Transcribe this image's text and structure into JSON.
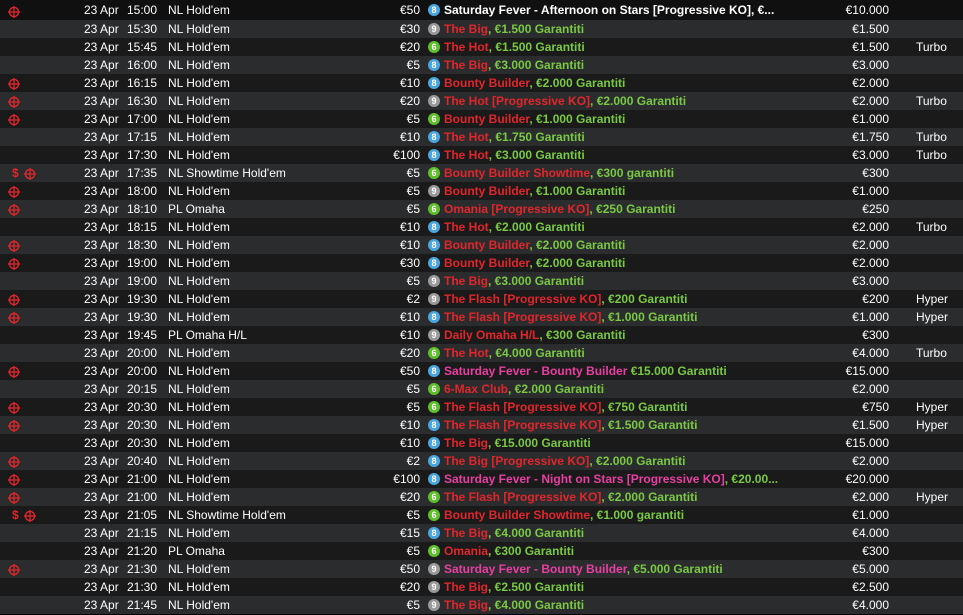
{
  "colors": {
    "red": "#e0262b",
    "pink": "#e83fa3",
    "green": "#7ac943",
    "alt_row": "#2b2c2e",
    "row": "#1a1a1a"
  },
  "rows": [
    {
      "flags": [
        "target-icon"
      ],
      "date": "23 Apr",
      "time": "15:00",
      "game": "NL Hold'em",
      "buyin": "€50",
      "speed": "8",
      "name_a": "Saturday Fever - Afternoon on Stars [Progressive KO], €...",
      "name_b": "",
      "style": "white",
      "prize": "€10.000",
      "type": ""
    },
    {
      "flags": [],
      "date": "23 Apr",
      "time": "15:30",
      "game": "NL Hold'em",
      "buyin": "€30",
      "speed": "9",
      "name_a": "The Big",
      "name_b": ", €1.500 Garantiti",
      "style": "red",
      "prize": "€1.500",
      "type": ""
    },
    {
      "flags": [],
      "date": "23 Apr",
      "time": "15:45",
      "game": "NL Hold'em",
      "buyin": "€20",
      "speed": "6",
      "name_a": "The Hot",
      "name_b": ", €1.500 Garantiti",
      "style": "red",
      "prize": "€1.500",
      "type": "Turbo"
    },
    {
      "flags": [],
      "date": "23 Apr",
      "time": "16:00",
      "game": "NL Hold'em",
      "buyin": "€5",
      "speed": "8",
      "name_a": "The Big",
      "name_b": ", €3.000 Garantiti",
      "style": "red",
      "prize": "€3.000",
      "type": ""
    },
    {
      "flags": [
        "target-icon"
      ],
      "date": "23 Apr",
      "time": "16:15",
      "game": "NL Hold'em",
      "buyin": "€10",
      "speed": "8",
      "name_a": "Bounty Builder",
      "name_b": ", €2.000 Garantiti",
      "style": "red",
      "prize": "€2.000",
      "type": ""
    },
    {
      "flags": [
        "target-icon"
      ],
      "date": "23 Apr",
      "time": "16:30",
      "game": "NL Hold'em",
      "buyin": "€20",
      "speed": "9",
      "name_a": "The Hot [Progressive KO]",
      "name_b": ", €2.000 Garantiti",
      "style": "red",
      "prize": "€2.000",
      "type": "Turbo"
    },
    {
      "flags": [
        "target-icon"
      ],
      "date": "23 Apr",
      "time": "17:00",
      "game": "NL Hold'em",
      "buyin": "€5",
      "speed": "6",
      "name_a": "Bounty Builder",
      "name_b": ", €1.000 Garantiti",
      "style": "red",
      "prize": "€1.000",
      "type": ""
    },
    {
      "flags": [],
      "date": "23 Apr",
      "time": "17:15",
      "game": "NL Hold'em",
      "buyin": "€10",
      "speed": "8",
      "name_a": "The Hot",
      "name_b": ", €1.750 Garantiti",
      "style": "red",
      "prize": "€1.750",
      "type": "Turbo"
    },
    {
      "flags": [],
      "date": "23 Apr",
      "time": "17:30",
      "game": "NL Hold'em",
      "buyin": "€100",
      "speed": "8",
      "name_a": "The Hot",
      "name_b": ", €3.000 Garantiti",
      "style": "red",
      "prize": "€3.000",
      "type": "Turbo"
    },
    {
      "flags": [
        "dollar-icon",
        "target-icon"
      ],
      "date": "23 Apr",
      "time": "17:35",
      "game": "NL Showtime Hold'em",
      "buyin": "€5",
      "speed": "6",
      "name_a": "Bounty Builder Showtime",
      "name_b": ", €300 garantiti",
      "style": "red",
      "prize": "€300",
      "type": ""
    },
    {
      "flags": [
        "target-icon"
      ],
      "date": "23 Apr",
      "time": "18:00",
      "game": "NL Hold'em",
      "buyin": "€5",
      "speed": "9",
      "name_a": "Bounty Builder",
      "name_b": ", €1.000 Garantiti",
      "style": "red",
      "prize": "€1.000",
      "type": ""
    },
    {
      "flags": [
        "target-icon"
      ],
      "date": "23 Apr",
      "time": "18:10",
      "game": "PL Omaha",
      "buyin": "€5",
      "speed": "6",
      "name_a": "Omania [Progressive KO]",
      "name_b": ", €250 Garantiti",
      "style": "red",
      "prize": "€250",
      "type": ""
    },
    {
      "flags": [],
      "date": "23 Apr",
      "time": "18:15",
      "game": "NL Hold'em",
      "buyin": "€10",
      "speed": "8",
      "name_a": "The Hot",
      "name_b": ", €2.000 Garantiti",
      "style": "red",
      "prize": "€2.000",
      "type": "Turbo"
    },
    {
      "flags": [
        "target-icon"
      ],
      "date": "23 Apr",
      "time": "18:30",
      "game": "NL Hold'em",
      "buyin": "€10",
      "speed": "8",
      "name_a": "Bounty Builder",
      "name_b": ", €2.000 Garantiti",
      "style": "red",
      "prize": "€2.000",
      "type": ""
    },
    {
      "flags": [
        "target-icon"
      ],
      "date": "23 Apr",
      "time": "19:00",
      "game": "NL Hold'em",
      "buyin": "€30",
      "speed": "8",
      "name_a": "Bounty Builder",
      "name_b": ", €2.000 Garantiti",
      "style": "red",
      "prize": "€2.000",
      "type": ""
    },
    {
      "flags": [],
      "date": "23 Apr",
      "time": "19:00",
      "game": "NL Hold'em",
      "buyin": "€5",
      "speed": "9",
      "name_a": "The Big",
      "name_b": ", €3.000 Garantiti",
      "style": "red",
      "prize": "€3.000",
      "type": ""
    },
    {
      "flags": [
        "target-icon"
      ],
      "date": "23 Apr",
      "time": "19:30",
      "game": "NL Hold'em",
      "buyin": "€2",
      "speed": "9",
      "name_a": "The Flash [Progressive KO]",
      "name_b": ", €200 Garantiti",
      "style": "red",
      "prize": "€200",
      "type": "Hyper"
    },
    {
      "flags": [
        "target-icon"
      ],
      "date": "23 Apr",
      "time": "19:30",
      "game": "NL Hold'em",
      "buyin": "€10",
      "speed": "8",
      "name_a": "The Flash [Progressive KO]",
      "name_b": ", €1.000 Garantiti",
      "style": "red",
      "prize": "€1.000",
      "type": "Hyper"
    },
    {
      "flags": [],
      "date": "23 Apr",
      "time": "19:45",
      "game": "PL Omaha H/L",
      "buyin": "€10",
      "speed": "9",
      "name_a": "Daily Omaha H/L",
      "name_b": ", €300 Garantiti",
      "style": "red",
      "prize": "€300",
      "type": ""
    },
    {
      "flags": [],
      "date": "23 Apr",
      "time": "20:00",
      "game": "NL Hold'em",
      "buyin": "€20",
      "speed": "6",
      "name_a": "The Hot",
      "name_b": ", €4.000 Garantiti",
      "style": "red",
      "prize": "€4.000",
      "type": "Turbo"
    },
    {
      "flags": [
        "target-icon"
      ],
      "date": "23 Apr",
      "time": "20:00",
      "game": "NL Hold'em",
      "buyin": "€50",
      "speed": "8",
      "name_a": "Saturday Fever - Bounty Builder",
      "name_b": " €15.000 Garantiti",
      "style": "pink",
      "prize": "€15.000",
      "type": ""
    },
    {
      "flags": [],
      "date": "23 Apr",
      "time": "20:15",
      "game": "NL Hold'em",
      "buyin": "€5",
      "speed": "6",
      "name_a": "6-Max Club",
      "name_b": ", €2.000 Garantiti",
      "style": "red",
      "prize": "€2.000",
      "type": ""
    },
    {
      "flags": [
        "target-icon"
      ],
      "date": "23 Apr",
      "time": "20:30",
      "game": "NL Hold'em",
      "buyin": "€5",
      "speed": "6",
      "name_a": "The Flash [Progressive KO]",
      "name_b": ", €750 Garantiti",
      "style": "red",
      "prize": "€750",
      "type": "Hyper"
    },
    {
      "flags": [
        "target-icon"
      ],
      "date": "23 Apr",
      "time": "20:30",
      "game": "NL Hold'em",
      "buyin": "€10",
      "speed": "8",
      "name_a": "The Flash [Progressive KO]",
      "name_b": ", €1.500 Garantiti",
      "style": "red",
      "prize": "€1.500",
      "type": "Hyper"
    },
    {
      "flags": [],
      "date": "23 Apr",
      "time": "20:30",
      "game": "NL Hold'em",
      "buyin": "€10",
      "speed": "8",
      "name_a": "The Big",
      "name_b": ", €15.000 Garantiti",
      "style": "red",
      "prize": "€15.000",
      "type": ""
    },
    {
      "flags": [
        "target-icon"
      ],
      "date": "23 Apr",
      "time": "20:40",
      "game": "NL Hold'em",
      "buyin": "€2",
      "speed": "8",
      "name_a": "The Big [Progressive KO]",
      "name_b": ", €2.000 Garantiti",
      "style": "red",
      "prize": "€2.000",
      "type": ""
    },
    {
      "flags": [
        "target-icon"
      ],
      "date": "23 Apr",
      "time": "21:00",
      "game": "NL Hold'em",
      "buyin": "€100",
      "speed": "8",
      "name_a": "Saturday Fever - Night on Stars [Progressive KO]",
      "name_b": ", €20.00...",
      "style": "pink",
      "prize": "€20.000",
      "type": ""
    },
    {
      "flags": [
        "target-icon"
      ],
      "date": "23 Apr",
      "time": "21:00",
      "game": "NL Hold'em",
      "buyin": "€20",
      "speed": "6",
      "name_a": "The Flash [Progressive KO]",
      "name_b": ", €2.000 Garantiti",
      "style": "red",
      "prize": "€2.000",
      "type": "Hyper"
    },
    {
      "flags": [
        "dollar-icon",
        "target-icon"
      ],
      "date": "23 Apr",
      "time": "21:05",
      "game": "NL Showtime Hold'em",
      "buyin": "€5",
      "speed": "6",
      "name_a": "Bounty Builder Showtime",
      "name_b": ", €1.000 garantiti",
      "style": "red",
      "prize": "€1.000",
      "type": ""
    },
    {
      "flags": [],
      "date": "23 Apr",
      "time": "21:15",
      "game": "NL Hold'em",
      "buyin": "€15",
      "speed": "8",
      "name_a": "The Big",
      "name_b": ", €4.000 Garantiti",
      "style": "red",
      "prize": "€4.000",
      "type": ""
    },
    {
      "flags": [],
      "date": "23 Apr",
      "time": "21:20",
      "game": "PL Omaha",
      "buyin": "€5",
      "speed": "6",
      "name_a": "Omania",
      "name_b": ", €300 Garantiti",
      "style": "red",
      "prize": "€300",
      "type": ""
    },
    {
      "flags": [
        "target-icon"
      ],
      "date": "23 Apr",
      "time": "21:30",
      "game": "NL Hold'em",
      "buyin": "€50",
      "speed": "9",
      "name_a": "Saturday Fever - Bounty Builder",
      "name_b": ", €5.000 Garantiti",
      "style": "pink",
      "prize": "€5.000",
      "type": ""
    },
    {
      "flags": [],
      "date": "23 Apr",
      "time": "21:30",
      "game": "NL Hold'em",
      "buyin": "€20",
      "speed": "9",
      "name_a": "The Big",
      "name_b": ", €2.500 Garantiti",
      "style": "red",
      "prize": "€2.500",
      "type": ""
    },
    {
      "flags": [],
      "date": "23 Apr",
      "time": "21:45",
      "game": "NL Hold'em",
      "buyin": "€5",
      "speed": "9",
      "name_a": "The Big",
      "name_b": ", €4.000 Garantiti",
      "style": "red",
      "prize": "€4.000",
      "type": ""
    }
  ]
}
